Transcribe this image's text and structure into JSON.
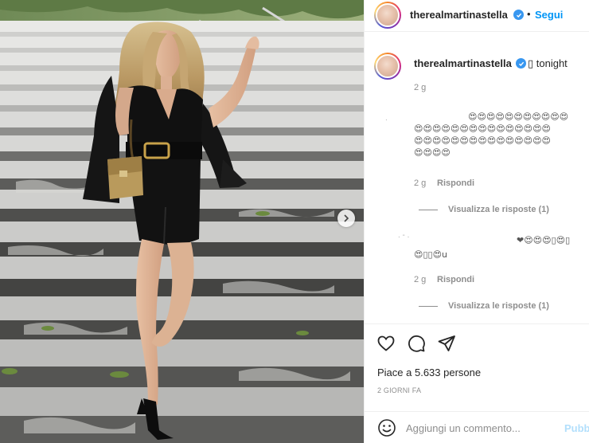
{
  "post": {
    "photo_alt": "woman in black dress on stairs",
    "next_icon": "chevron-right-icon"
  },
  "header": {
    "username": "therealmartinastella",
    "verified_icon": "verified-badge-icon",
    "separator": "•",
    "follow_label": "Segui"
  },
  "caption": {
    "username": "therealmartinastella",
    "text": "▯ tonight",
    "time": "2 g"
  },
  "comments": [
    {
      "faint_user": ".",
      "emojis": "😍😍😍😍😍😍😍😍😍😍😍😍😍😍😍😍😍😍😍😍😍😍😍😍😍😍😍😍😍😍😍😍😍😍😍😍😍😍😍😍😍😍😍😍😍😍😍😍😍😍",
      "time": "2 g",
      "reply_label": "Rispondi",
      "view_replies": "Visualizza le risposte (1)"
    },
    {
      "faint_user": ".   -       .",
      "emojis_line1": "❤😍😍😍▯😍▯",
      "emojis_line2": "😍▯▯😍u",
      "time": "2 g",
      "reply_label": "Rispondi",
      "view_replies": "Visualizza le risposte (1)"
    }
  ],
  "actions": {
    "like_icon": "heart-icon",
    "comment_icon": "comment-icon",
    "share_icon": "share-icon",
    "likes_text": "Piace a 5.633 persone",
    "date_text": "2 GIORNI FA"
  },
  "comment_box": {
    "emoji_icon": "smiley-icon",
    "placeholder": "Aggiungi un commento...",
    "post_label": "Pubb"
  }
}
